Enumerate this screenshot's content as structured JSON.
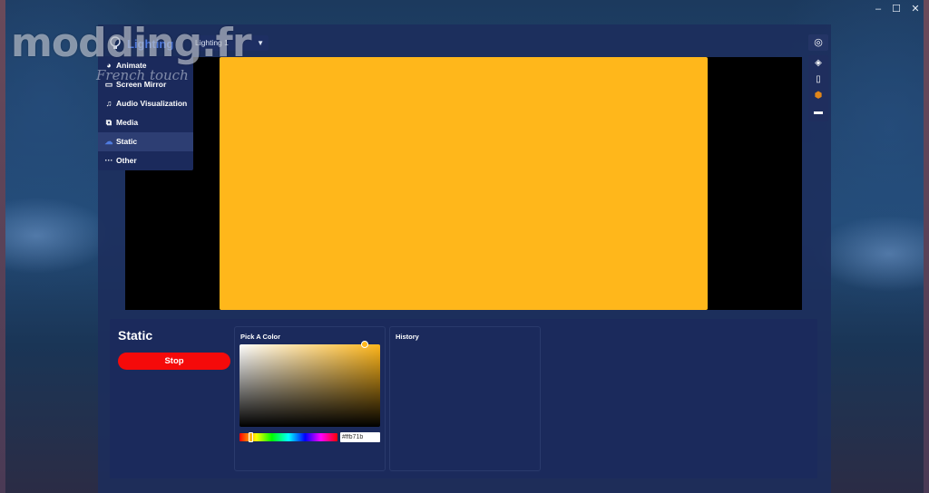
{
  "window": {
    "controls": {
      "minimize": "–",
      "maximize": "☐",
      "close": "✕"
    }
  },
  "watermark": {
    "text": "modding.fr",
    "subtext": "French touch"
  },
  "header": {
    "title": "Lighting",
    "icon": "bulb-icon",
    "profile_select": {
      "value": "Lighting 1",
      "caret": "▼"
    }
  },
  "menu": {
    "items": [
      {
        "label": "Animate",
        "icon": "palette-icon",
        "glyph": "◕"
      },
      {
        "label": "Screen Mirror",
        "icon": "monitor-icon",
        "glyph": "▭"
      },
      {
        "label": "Audio Visualization",
        "icon": "music-icon",
        "glyph": "♫"
      },
      {
        "label": "Media",
        "icon": "media-icon",
        "glyph": "⧉"
      },
      {
        "label": "Static",
        "icon": "static-icon",
        "glyph": "☁",
        "active": true
      },
      {
        "label": "Other",
        "icon": "more-icon",
        "glyph": "···"
      }
    ]
  },
  "preview": {
    "color": "#ffb71b",
    "background": "#000000"
  },
  "right_tools": {
    "top": {
      "icon": "fingerprint-icon",
      "glyph": "◎"
    },
    "items": [
      {
        "icon": "layers-icon",
        "glyph": "◈"
      },
      {
        "icon": "device-icon",
        "glyph": "▯"
      },
      {
        "icon": "hub-icon",
        "glyph": "⬢"
      },
      {
        "icon": "strip-icon",
        "glyph": "▬"
      }
    ]
  },
  "panel": {
    "title": "Static",
    "stop_label": "Stop",
    "pick_color": {
      "title": "Pick A Color",
      "hex_value": "#ffb71b",
      "selected_color": "#ffb71b"
    },
    "history": {
      "title": "History"
    }
  },
  "colors": {
    "accent": "#4f7be0",
    "stop_button": "#f50a0a",
    "selected": "#ffb71b"
  }
}
